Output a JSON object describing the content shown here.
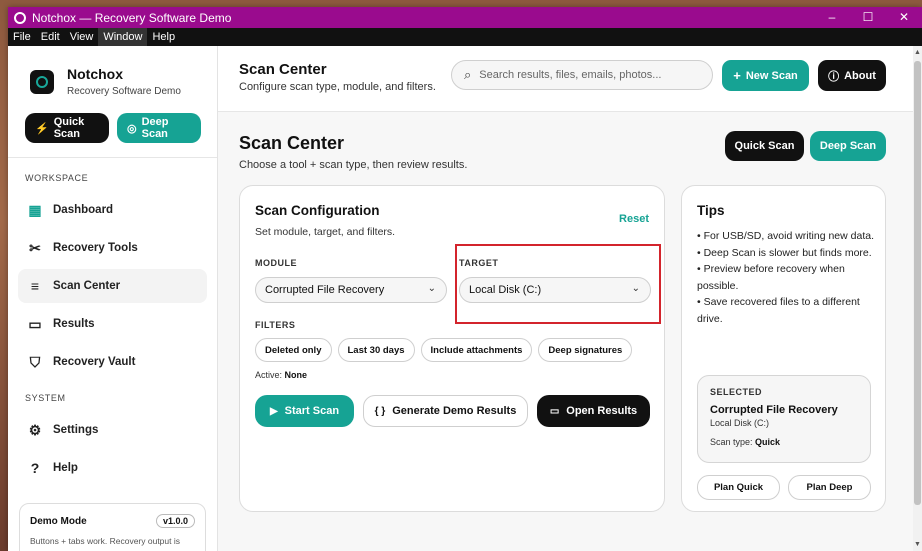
{
  "window": {
    "title": "Notchox — Recovery Software Demo",
    "controls": [
      "–",
      "☐",
      "✕"
    ]
  },
  "menu": [
    "File",
    "Edit",
    "View",
    "Window",
    "Help"
  ],
  "sidebar": {
    "brand_name": "Notchox",
    "brand_sub": "Recovery Software Demo",
    "quick_scan": "Quick Scan",
    "deep_scan": "Deep Scan",
    "workspace_label": "WORKSPACE",
    "system_label": "SYSTEM",
    "items": [
      {
        "label": "Dashboard",
        "icon": "dashboard-icon"
      },
      {
        "label": "Recovery Tools",
        "icon": "tools-icon"
      },
      {
        "label": "Scan Center",
        "icon": "scan-icon"
      },
      {
        "label": "Results",
        "icon": "folder-icon"
      },
      {
        "label": "Recovery Vault",
        "icon": "shield-icon"
      },
      {
        "label": "Settings",
        "icon": "gear-icon"
      },
      {
        "label": "Help",
        "icon": "help-icon"
      }
    ],
    "demo_title": "Demo Mode",
    "demo_version": "v1.0.0",
    "demo_text": "Buttons + tabs work. Recovery output is"
  },
  "topbar": {
    "title": "Scan Center",
    "subtitle": "Configure scan type, module, and filters.",
    "search_placeholder": "Search results, files, emails, photos...",
    "new_scan": "New Scan",
    "about": "About"
  },
  "page": {
    "title": "Scan Center",
    "subtitle": "Choose a tool + scan type, then review results.",
    "quick_scan": "Quick Scan",
    "deep_scan": "Deep Scan"
  },
  "config": {
    "title": "Scan Configuration",
    "subtitle": "Set module, target, and filters.",
    "reset": "Reset",
    "module_label": "MODULE",
    "module_value": "Corrupted File Recovery",
    "target_label": "TARGET",
    "target_value": "Local Disk (C:)",
    "filters_label": "FILTERS",
    "filters": [
      "Deleted only",
      "Last 30 days",
      "Include attachments",
      "Deep signatures"
    ],
    "active_label": "Active:",
    "active_value": "None",
    "start_scan": "Start Scan",
    "generate": "Generate Demo Results",
    "open_results": "Open Results"
  },
  "tips": {
    "title": "Tips",
    "items": [
      "• For USB/SD, avoid writing new data.",
      "• Deep Scan is slower but finds more.",
      "• Preview before recovery when possible.",
      "• Save recovered files to a different drive."
    ],
    "selected_label": "SELECTED",
    "selected_name": "Corrupted File Recovery",
    "selected_target": "Local Disk (C:)",
    "scan_type_label": "Scan type:",
    "scan_type_value": "Quick",
    "plan_quick": "Plan Quick",
    "plan_deep": "Plan Deep"
  },
  "colors": {
    "titlebar": "#9a0b8e",
    "accent": "#16a394",
    "highlight": "#d3242c"
  }
}
